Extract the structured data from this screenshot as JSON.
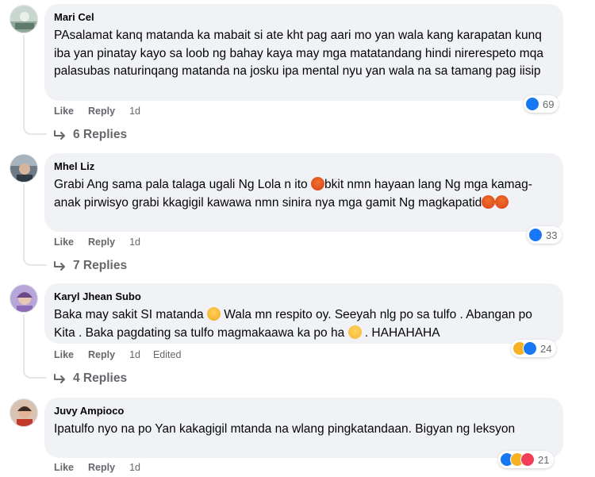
{
  "comments": [
    {
      "author": "Mari Cel",
      "text": "PAsalamat kanq matanda ka mabait si ate kht pag aari mo yan wala kang karapatan kunq iba yan pinatay kayo sa loob ng bahay kaya may mga matatandang hindi nirerespeto mqa palasubas naturinqang matanda na josku ipa mental nyu yan wala na sa tamang pag iisip",
      "like": "Like",
      "reply": "Reply",
      "time": "1d",
      "reaction_count": "69",
      "replies": "6 Replies"
    },
    {
      "author": "Mhel Liz",
      "text_a": "Grabi Ang sama pala talaga ugali Ng Lola n ito ",
      "text_b": "bkit nmn hayaan lang Ng mga kamag-anak pirwisyo grabi kkagigil kawawa nmn sinira nya mga gamit Ng magkapatid",
      "like": "Like",
      "reply": "Reply",
      "time": "1d",
      "reaction_count": "33",
      "replies": "7 Replies"
    },
    {
      "author": "Karyl Jhean Subo",
      "text_a": "Baka may sakit SI matanda ",
      "text_b": " Wala mn respito oy. Seeyah nlg po sa tulfo . Abangan po Kita . Baka pagdating sa tulfo magmakaawa ka po ha ",
      "text_c": " . HAHAHAHA",
      "like": "Like",
      "reply": "Reply",
      "time": "1d",
      "edited": "Edited",
      "reaction_count": "24",
      "replies": "4 Replies"
    },
    {
      "author": "Juvy Ampioco",
      "text": "Ipatulfo nyo na po Yan kakagigil mtanda na wlang pingkatandaan. Bigyan ng leksyon",
      "like": "Like",
      "reply": "Reply",
      "time": "1d",
      "reaction_count": "21"
    }
  ],
  "colors": {
    "bubble": "#f0f2f5",
    "meta": "#65676b",
    "like_blue": "#1877f2"
  }
}
